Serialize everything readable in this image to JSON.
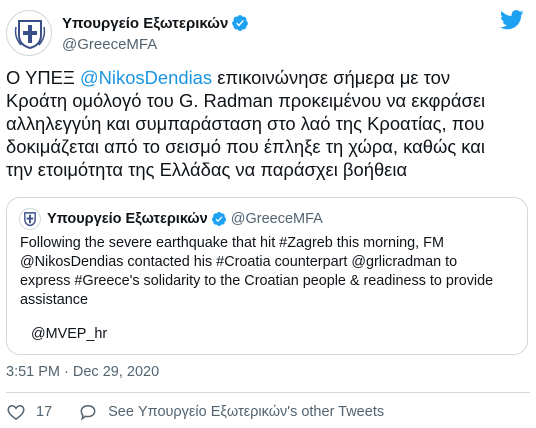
{
  "author": {
    "display_name": "Υπουργείο Εξωτερικών",
    "handle": "@GreeceMFA"
  },
  "tweet": {
    "lines": [
      {
        "before": "Ο ΥΠΕΞ ",
        "mention": "@NikosDendias",
        "after": " επικοινώνησε σήμερα με τον"
      },
      {
        "before": "Κροάτη ομόλογό του G. Radman προκειμένου να εκφράσει",
        "mention": "",
        "after": ""
      },
      {
        "before": "αλληλεγγύη και συμπαράσταση στο λαό της Κροατίας, που",
        "mention": "",
        "after": ""
      },
      {
        "before": "δοκιμάζεται από το σεισμό που έπληξε τη χώρα, καθώς και",
        "mention": "",
        "after": ""
      },
      {
        "before": "την ετοιμότητα της Ελλάδας να παράσχει βοήθεια",
        "mention": "",
        "after": ""
      }
    ]
  },
  "quoted": {
    "display_name": "Υπουργείο Εξωτερικών",
    "handle": "@GreeceMFA",
    "lines": [
      "Following the severe earthquake that hit #Zagreb this morning, FM",
      "@NikosDendias contacted his #Croatia counterpart @grlicradman to",
      "express #Greece's solidarity to the Croatian people & readiness to provide",
      "assistance"
    ],
    "tag": "@MVEP_hr"
  },
  "timestamp": "3:51 PM · Dec 29, 2020",
  "actions": {
    "like_count": "17",
    "other_tweets_label": "See Υπουργείο Εξωτερικών's other Tweets"
  },
  "icons": {
    "verified": "verified-badge-icon",
    "brand": "twitter-bird-icon",
    "like": "heart-icon",
    "reply": "speech-bubble-icon"
  },
  "colors": {
    "link": "#1b95e0",
    "twitter_blue": "#1da1f2",
    "secondary_text": "#536471",
    "border": "#cfd9de"
  }
}
